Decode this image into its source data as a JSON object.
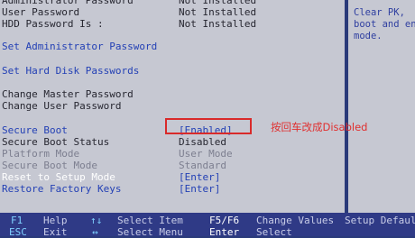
{
  "rows": [
    {
      "label": "Administrator Password",
      "value": "Not Installed",
      "cls": "lbl",
      "vcls": ""
    },
    {
      "label": "User Password",
      "value": "Not Installed",
      "cls": "lbl",
      "vcls": ""
    },
    {
      "label": "HDD Password Is :",
      "value": "Not Installed",
      "cls": "lbl",
      "vcls": ""
    },
    {
      "label": "Set Administrator Password",
      "value": "",
      "cls": "lbl-blue",
      "vcls": ""
    },
    {
      "label": "Set Hard Disk Passwords",
      "value": "",
      "cls": "lbl-blue",
      "vcls": ""
    },
    {
      "label": "Change Master Password",
      "value": "",
      "cls": "lbl",
      "vcls": ""
    },
    {
      "label": "Change User Password",
      "value": "",
      "cls": "lbl",
      "vcls": ""
    },
    {
      "label": "Secure Boot",
      "value": "[Enabled]",
      "cls": "lbl-blue",
      "vcls": "val-blue"
    },
    {
      "label": "Secure Boot Status",
      "value": "Disabled",
      "cls": "lbl",
      "vcls": ""
    },
    {
      "label": "Platform Mode",
      "value": "User Mode",
      "cls": "lbl-grey",
      "vcls": "val-grey"
    },
    {
      "label": "Secure Boot Mode",
      "value": "Standard",
      "cls": "lbl-grey",
      "vcls": "val-grey"
    },
    {
      "label": "Reset to Setup Mode",
      "value": "[Enter]",
      "cls": "lbl-white",
      "vcls": "val-blue"
    },
    {
      "label": "Restore Factory Keys",
      "value": "[Enter]",
      "cls": "lbl-blue",
      "vcls": "val-blue"
    }
  ],
  "help_text": "Clear PK,\nboot and en\nmode.",
  "annotation": "按回车改成Disabled",
  "footer": {
    "f1_key": "F1",
    "f1_desc": "Help",
    "esc_key": "ESC",
    "esc_desc": "Exit",
    "updown_key": "↑↓",
    "updown_desc": "Select Item",
    "leftright_key": "↔",
    "leftright_desc": "Select Menu",
    "f5f6_key": "F5/F6",
    "f5f6_desc": "Change Values",
    "enter_key": "Enter",
    "enter_desc": "Select",
    "sub_desc": "Setup Defaults"
  }
}
